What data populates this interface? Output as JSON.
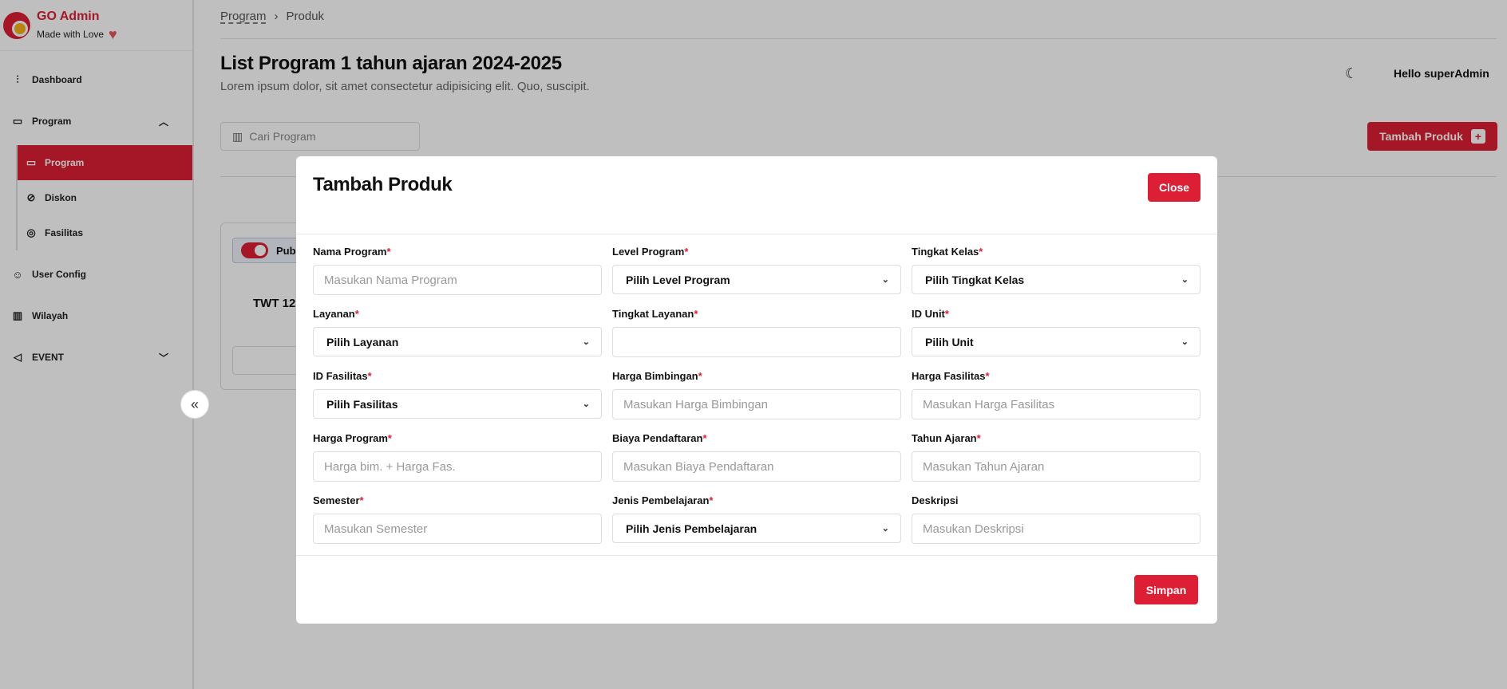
{
  "brand": {
    "title": "GO Admin",
    "subtitle": "Made with Love"
  },
  "sidebar": {
    "items": [
      {
        "label": "Dashboard",
        "icon": "chart-icon"
      },
      {
        "label": "Program",
        "icon": "book-icon"
      },
      {
        "label": "User Config",
        "icon": "user-icon"
      },
      {
        "label": "Wilayah",
        "icon": "building-icon"
      },
      {
        "label": "EVENT",
        "icon": "megaphone-icon"
      }
    ],
    "sub_items": [
      {
        "label": "Program",
        "icon": "book-icon",
        "active": true
      },
      {
        "label": "Diskon",
        "icon": "discount-icon"
      },
      {
        "label": "Fasilitas",
        "icon": "target-icon"
      }
    ]
  },
  "breadcrumb": {
    "parent": "Program",
    "current": "Produk"
  },
  "page": {
    "title": "List Program 1 tahun ajaran 2024-2025",
    "subtitle": "Lorem ipsum dolor, sit amet consectetur adipisicing elit. Quo, suscipit.",
    "greeting": "Hello superAdmin"
  },
  "search": {
    "placeholder": "Cari Program"
  },
  "add_button": {
    "label": "Tambah Produk"
  },
  "card": {
    "publish_label": "Pub",
    "title": "TWT 12"
  },
  "modal": {
    "title": "Tambah Produk",
    "close_label": "Close",
    "save_label": "Simpan",
    "fields": [
      {
        "label": "Nama Program",
        "required": true,
        "type": "input",
        "placeholder": "Masukan Nama Program"
      },
      {
        "label": "Level Program",
        "required": true,
        "type": "select",
        "value": "Pilih Level Program"
      },
      {
        "label": "Tingkat Kelas",
        "required": true,
        "type": "select",
        "value": "Pilih Tingkat Kelas"
      },
      {
        "label": "Layanan",
        "required": true,
        "type": "select",
        "value": "Pilih Layanan"
      },
      {
        "label": "Tingkat Layanan",
        "required": true,
        "type": "input",
        "placeholder": ""
      },
      {
        "label": "ID Unit",
        "required": true,
        "type": "select",
        "value": "Pilih Unit"
      },
      {
        "label": "ID Fasilitas",
        "required": true,
        "type": "select",
        "value": "Pilih Fasilitas"
      },
      {
        "label": "Harga Bimbingan",
        "required": true,
        "type": "input",
        "placeholder": "Masukan Harga Bimbingan"
      },
      {
        "label": "Harga Fasilitas",
        "required": true,
        "type": "input",
        "placeholder": "Masukan Harga Fasilitas"
      },
      {
        "label": "Harga Program",
        "required": true,
        "type": "input",
        "placeholder": "Harga bim. + Harga Fas."
      },
      {
        "label": "Biaya Pendaftaran",
        "required": true,
        "type": "input",
        "placeholder": "Masukan Biaya Pendaftaran"
      },
      {
        "label": "Tahun Ajaran",
        "required": true,
        "type": "input",
        "placeholder": "Masukan Tahun Ajaran"
      },
      {
        "label": "Semester",
        "required": true,
        "type": "input",
        "placeholder": "Masukan Semester"
      },
      {
        "label": "Jenis Pembelajaran",
        "required": true,
        "type": "select",
        "value": "Pilih Jenis Pembelajaran"
      },
      {
        "label": "Deskripsi",
        "required": false,
        "type": "input",
        "placeholder": "Masukan Deskripsi"
      }
    ]
  },
  "colors": {
    "accent": "#dc1f35",
    "overlay": "rgba(0,0,0,0.25)"
  }
}
